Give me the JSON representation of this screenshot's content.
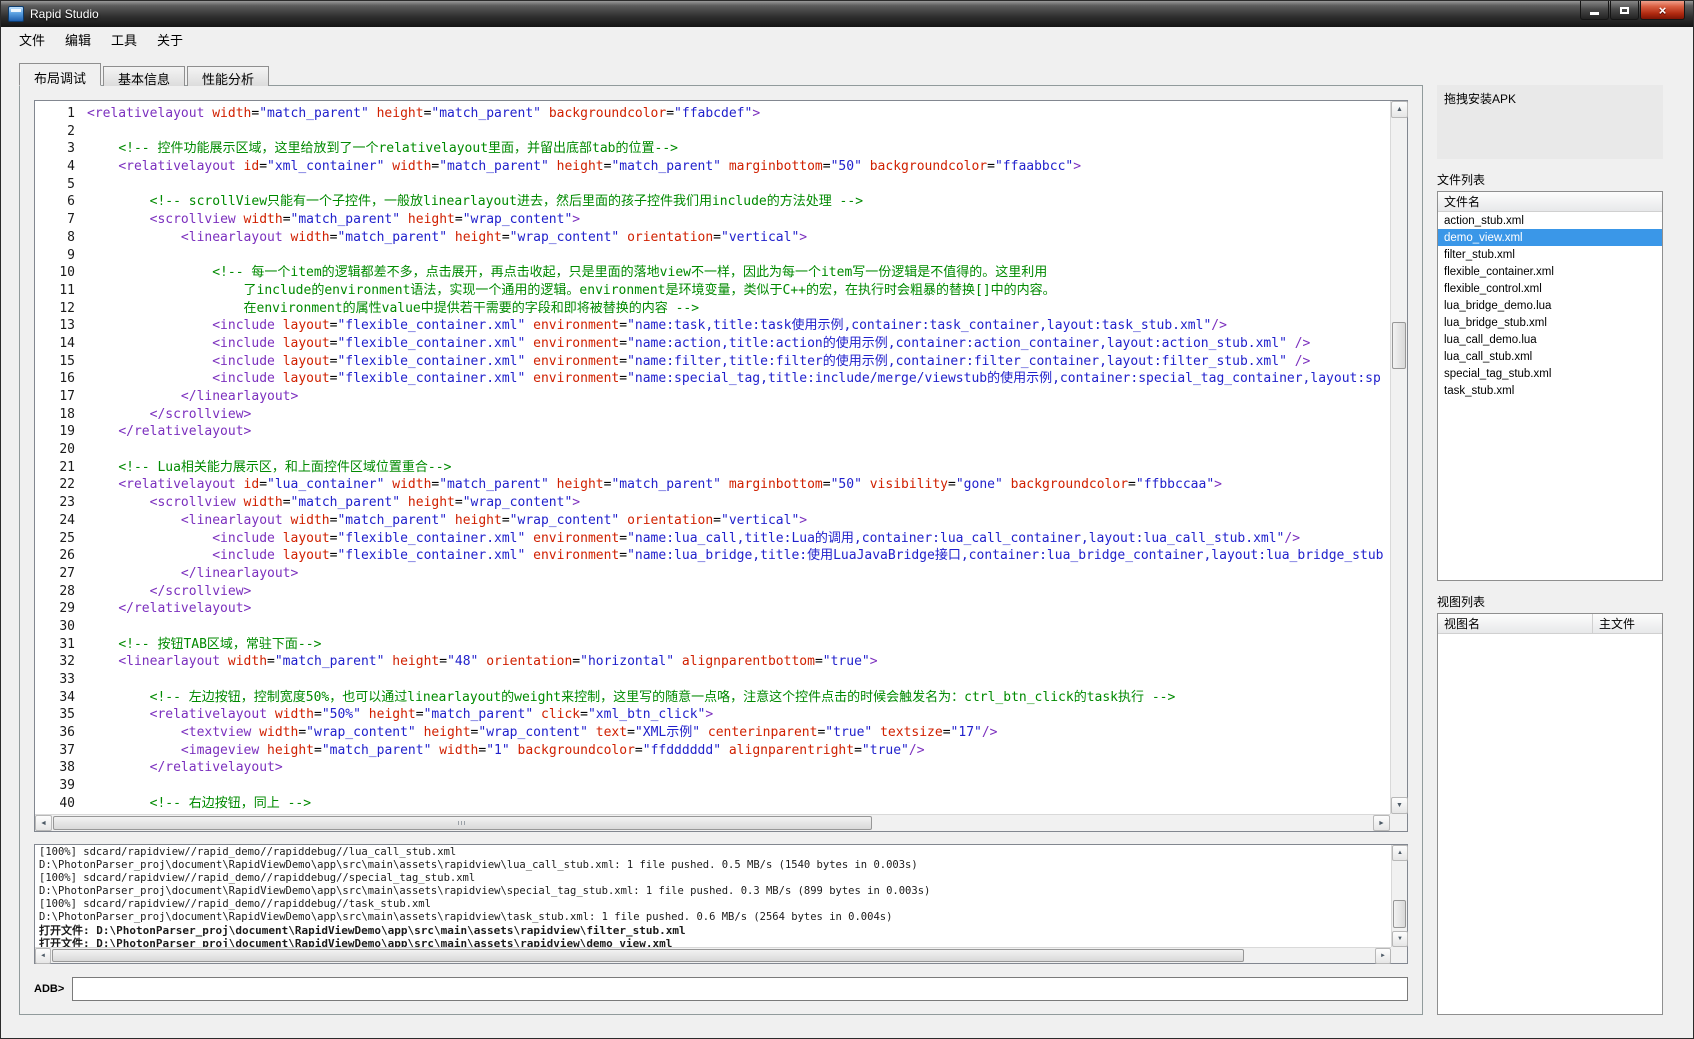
{
  "window": {
    "title": "Rapid Studio"
  },
  "menu": {
    "items": [
      {
        "id": "file",
        "label": "文件"
      },
      {
        "id": "edit",
        "label": "编辑"
      },
      {
        "id": "tools",
        "label": "工具"
      },
      {
        "id": "about",
        "label": "关于"
      }
    ]
  },
  "tabs": [
    {
      "id": "layout-debug",
      "label": "布局调试",
      "active": true
    },
    {
      "id": "basic-info",
      "label": "基本信息",
      "active": false
    },
    {
      "id": "performance",
      "label": "性能分析",
      "active": false
    }
  ],
  "editor": {
    "language": "xml",
    "lines": [
      "<relativelayout width=\"match_parent\" height=\"match_parent\" backgroundcolor=\"ffabcdef\">",
      "",
      "    <!-- 控件功能展示区域，这里给放到了一个relativelayout里面，并留出底部tab的位置-->",
      "    <relativelayout id=\"xml_container\" width=\"match_parent\" height=\"match_parent\" marginbottom=\"50\" backgroundcolor=\"ffaabbcc\">",
      "",
      "        <!-- scrollView只能有一个子控件，一般放linearlayout进去，然后里面的孩子控件我们用include的方法处理 -->",
      "        <scrollview width=\"match_parent\" height=\"wrap_content\">",
      "            <linearlayout width=\"match_parent\" height=\"wrap_content\" orientation=\"vertical\">",
      "",
      "                <!-- 每一个item的逻辑都差不多，点击展开，再点击收起，只是里面的落地view不一样，因此为每一个item写一份逻辑是不值得的。这里利用",
      "                    了include的environment语法，实现一个通用的逻辑。environment是环境变量，类似于C++的宏，在执行时会粗暴的替换[]中的内容。",
      "                    在environment的属性value中提供若干需要的字段和即将被替换的内容 -->",
      "                <include layout=\"flexible_container.xml\" environment=\"name:task,title:task使用示例,container:task_container,layout:task_stub.xml\"/>",
      "                <include layout=\"flexible_container.xml\" environment=\"name:action,title:action的使用示例,container:action_container,layout:action_stub.xml\" />",
      "                <include layout=\"flexible_container.xml\" environment=\"name:filter,title:filter的使用示例,container:filter_container,layout:filter_stub.xml\" />",
      "                <include layout=\"flexible_container.xml\" environment=\"name:special_tag,title:include/merge/viewstub的使用示例,container:special_tag_container,layout:sp",
      "            </linearlayout>",
      "        </scrollview>",
      "    </relativelayout>",
      "",
      "    <!-- Lua相关能力展示区，和上面控件区域位置重合-->",
      "    <relativelayout id=\"lua_container\" width=\"match_parent\" height=\"match_parent\" marginbottom=\"50\" visibility=\"gone\" backgroundcolor=\"ffbbccaa\">",
      "        <scrollview width=\"match_parent\" height=\"wrap_content\">",
      "            <linearlayout width=\"match_parent\" height=\"wrap_content\" orientation=\"vertical\">",
      "                <include layout=\"flexible_container.xml\" environment=\"name:lua_call,title:Lua的调用,container:lua_call_container,layout:lua_call_stub.xml\"/>",
      "                <include layout=\"flexible_container.xml\" environment=\"name:lua_bridge,title:使用LuaJavaBridge接口,container:lua_bridge_container,layout:lua_bridge_stub",
      "            </linearlayout>",
      "        </scrollview>",
      "    </relativelayout>",
      "",
      "    <!-- 按钮TAB区域，常驻下面-->",
      "    <linearlayout width=\"match_parent\" height=\"48\" orientation=\"horizontal\" alignparentbottom=\"true\">",
      "",
      "        <!-- 左边按钮，控制宽度50%，也可以通过linearlayout的weight来控制，这里写的随意一点咯，注意这个控件点击的时候会触发名为：ctrl_btn_click的task执行 -->",
      "        <relativelayout width=\"50%\" height=\"match_parent\" click=\"xml_btn_click\">",
      "            <textview width=\"wrap_content\" height=\"wrap_content\" text=\"XML示例\" centerinparent=\"true\" textsize=\"17\"/>",
      "            <imageview height=\"match_parent\" width=\"1\" backgroundcolor=\"ffdddddd\" alignparentright=\"true\"/>",
      "        </relativelayout>",
      "",
      "        <!-- 右边按钮，同上 -->"
    ]
  },
  "log": {
    "lines": [
      {
        "text": "[100%] sdcard/rapidview//rapid_demo//rapiddebug//lua_call_stub.xml",
        "emphasis": false
      },
      {
        "text": "D:\\PhotonParser_proj\\document\\RapidViewDemo\\app\\src\\main\\assets\\rapidview\\lua_call_stub.xml: 1 file pushed. 0.5 MB/s (1540 bytes in 0.003s)",
        "emphasis": false
      },
      {
        "text": "[100%] sdcard/rapidview//rapid_demo//rapiddebug//special_tag_stub.xml",
        "emphasis": false
      },
      {
        "text": "D:\\PhotonParser_proj\\document\\RapidViewDemo\\app\\src\\main\\assets\\rapidview\\special_tag_stub.xml: 1 file pushed. 0.3 MB/s (899 bytes in 0.003s)",
        "emphasis": false
      },
      {
        "text": "[100%] sdcard/rapidview//rapid_demo//rapiddebug//task_stub.xml",
        "emphasis": false
      },
      {
        "text": "D:\\PhotonParser_proj\\document\\RapidViewDemo\\app\\src\\main\\assets\\rapidview\\task_stub.xml: 1 file pushed. 0.6 MB/s (2564 bytes in 0.004s)",
        "emphasis": false
      },
      {
        "text": "打开文件: D:\\PhotonParser_proj\\document\\RapidViewDemo\\app\\src\\main\\assets\\rapidview\\filter_stub.xml",
        "emphasis": true
      },
      {
        "text": "打开文件: D:\\PhotonParser_proj\\document\\RapidViewDemo\\app\\src\\main\\assets\\rapidview\\demo_view.xml",
        "emphasis": true
      }
    ]
  },
  "adb": {
    "label": "ADB>",
    "value": ""
  },
  "sidebar": {
    "apk_drop_label": "拖拽安装APK",
    "file_list_title": "文件列表",
    "file_list_header": "文件名",
    "files": [
      "action_stub.xml",
      "demo_view.xml",
      "filter_stub.xml",
      "flexible_container.xml",
      "flexible_control.xml",
      "lua_bridge_demo.lua",
      "lua_bridge_stub.xml",
      "lua_call_demo.lua",
      "lua_call_stub.xml",
      "special_tag_stub.xml",
      "task_stub.xml"
    ],
    "selected_file": "demo_view.xml",
    "view_list_title": "视图列表",
    "view_list_headers": [
      "视图名",
      "主文件"
    ],
    "views": []
  },
  "colors": {
    "selection": "#3a97e8",
    "syntax_tag": "#7b2fbe",
    "syntax_attr": "#d02000",
    "syntax_value": "#2121cc",
    "syntax_comment": "#008a00"
  }
}
